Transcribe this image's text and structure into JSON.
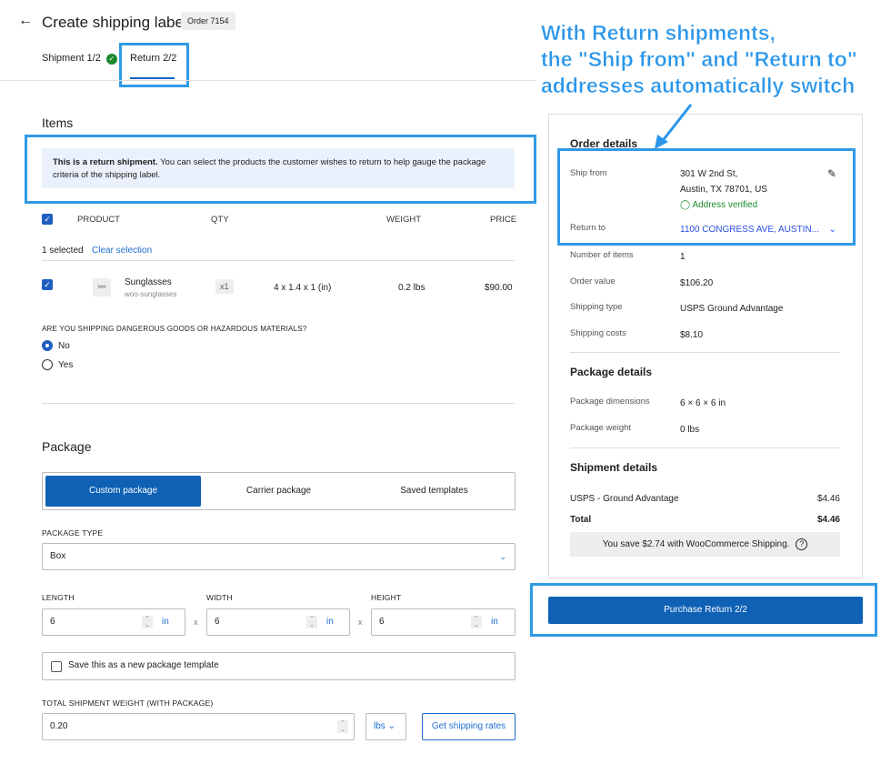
{
  "header": {
    "back": "←",
    "title": "Create shipping label",
    "order_badge": "Order 7154"
  },
  "tabs": [
    {
      "label": "Shipment 1/2",
      "done": true
    },
    {
      "label": "Return 2/2",
      "active": true
    }
  ],
  "items": {
    "heading": "Items",
    "notice_bold": "This is a return shipment.",
    "notice_text": " You can select the products the customer wishes to return to help gauge the package criteria of the shipping label.",
    "columns": [
      "PRODUCT",
      "QTY",
      "WEIGHT",
      "PRICE"
    ],
    "selected": "1 selected",
    "clear": "Clear selection",
    "rows": [
      {
        "name": "Sunglasses",
        "sku": "woo-sunglasses",
        "qty": "x1",
        "dims": "4 x 1.4 x 1 (in)",
        "weight": "0.2 lbs",
        "price": "$90.00"
      }
    ],
    "hazmat_q": "ARE YOU SHIPPING DANGEROUS GOODS OR HAZARDOUS MATERIALS?",
    "no": "No",
    "yes": "Yes"
  },
  "package": {
    "heading": "Package",
    "tabs": [
      "Custom package",
      "Carrier package",
      "Saved templates"
    ],
    "type_label": "PACKAGE TYPE",
    "type_value": "Box",
    "length_label": "LENGTH",
    "width_label": "WIDTH",
    "height_label": "HEIGHT",
    "length": "6",
    "width": "6",
    "height": "6",
    "unit": "in",
    "times": "x",
    "save_template": "Save this as a new package template",
    "weight_label": "TOTAL SHIPMENT WEIGHT (WITH PACKAGE)",
    "weight": "0.20",
    "weight_unit": "lbs",
    "get_rates": "Get shipping rates"
  },
  "order_details": {
    "heading": "Order details",
    "ship_from_label": "Ship from",
    "ship_from_1": "301 W 2nd St,",
    "ship_from_2": "Austin, TX 78701, US",
    "verified": "Address verified",
    "return_to_label": "Return to",
    "return_to": "1100 CONGRESS AVE, AUSTIN...",
    "rows": [
      {
        "k": "Number of items",
        "v": "1"
      },
      {
        "k": "Order value",
        "v": "$106.20"
      },
      {
        "k": "Shipping type",
        "v": "USPS Ground Advantage"
      },
      {
        "k": "Shipping costs",
        "v": "$8.10"
      }
    ]
  },
  "package_details": {
    "heading": "Package details",
    "rows": [
      {
        "k": "Package dimensions",
        "v": "6 × 6 × 6 in"
      },
      {
        "k": "Package weight",
        "v": "0 lbs"
      }
    ]
  },
  "shipment_details": {
    "heading": "Shipment details",
    "service": "USPS - Ground Advantage",
    "service_price": "$4.46",
    "total_label": "Total",
    "total": "$4.46",
    "savings": "You save $2.74 with WooCommerce Shipping."
  },
  "purchase": "Purchase Return 2/2",
  "callout": [
    "With Return shipments,",
    "the \"Ship from\" and \"Return to\"",
    "addresses automatically switch"
  ],
  "colors": {
    "accent": "#0e61b5",
    "annotation": "#2a96ea",
    "verified": "#1a8a2e"
  }
}
